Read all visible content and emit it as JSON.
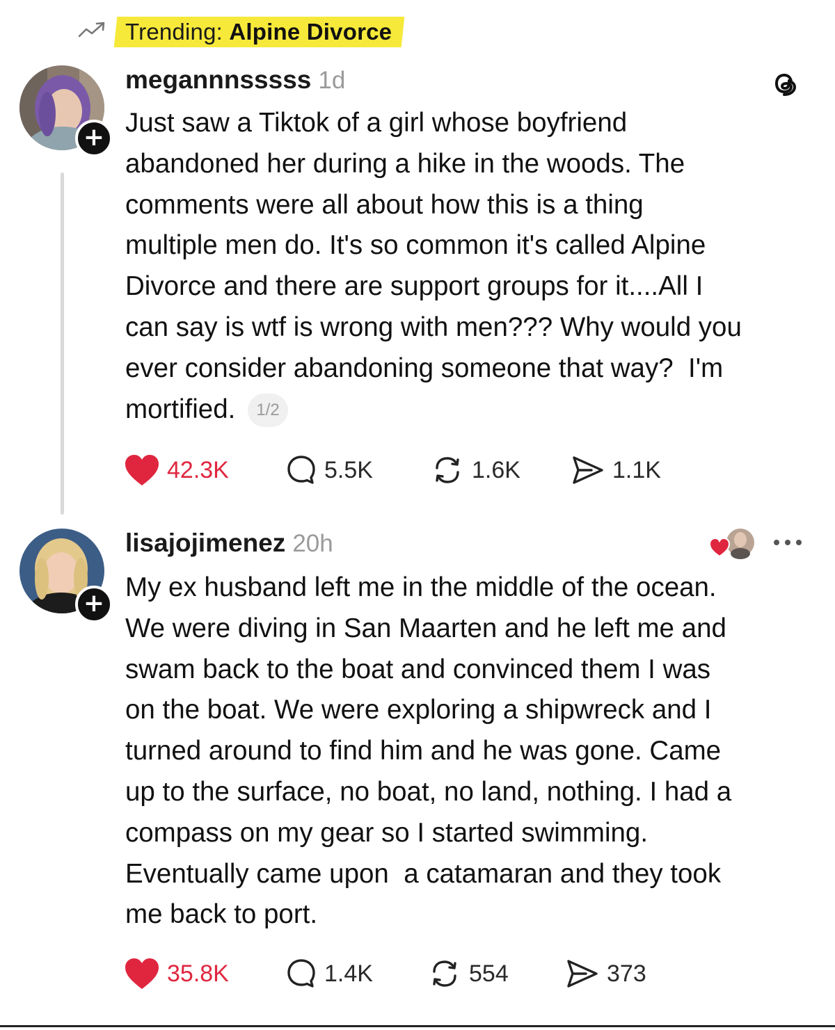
{
  "trending": {
    "label": "Trending:",
    "topic": "Alpine Divorce"
  },
  "icons": {
    "trend": "trending-arrow-icon",
    "follow": "plus-icon",
    "app": "threads-logo-icon",
    "like": "heart-icon",
    "reply": "speech-bubble-icon",
    "repost": "repost-icon",
    "share": "send-icon",
    "more": "more-dots-icon"
  },
  "colors": {
    "highlight": "#f6e93a",
    "like": "#e0263f",
    "muted": "#9a9a9a"
  },
  "posts": [
    {
      "username": "megannnsssss",
      "time": "1d",
      "lines": [
        "Just saw a Tiktok of a girl whose boyfriend",
        "abandoned her during a hike in the woods. The",
        "comments were all about how this is a thing",
        "multiple men do. It's so common it's called Alpine",
        "Divorce and there are support groups for it....All I",
        "can say is wtf is wrong with men??? Why would you",
        "ever consider abandoning someone that way?  I'm",
        "mortified."
      ],
      "page_indicator": "1/2",
      "likes": "42.3K",
      "replies": "5.5K",
      "reposts": "1.6K",
      "shares": "1.1K"
    },
    {
      "username": "lisajojimenez",
      "time": "20h",
      "lines": [
        "My ex husband left me in the middle of the ocean.",
        "We were diving in San Maarten and he left me and",
        "swam back to the boat and convinced them I was",
        "on the boat. We were exploring a shipwreck and I",
        "turned around to find him and he was gone. Came",
        "up to the surface, no boat, no land, nothing. I had a",
        "compass on my gear so I started swimming.",
        "Eventually came upon  a catamaran and they took",
        "me back to port."
      ],
      "likes": "35.8K",
      "replies": "1.4K",
      "reposts": "554",
      "shares": "373"
    }
  ]
}
